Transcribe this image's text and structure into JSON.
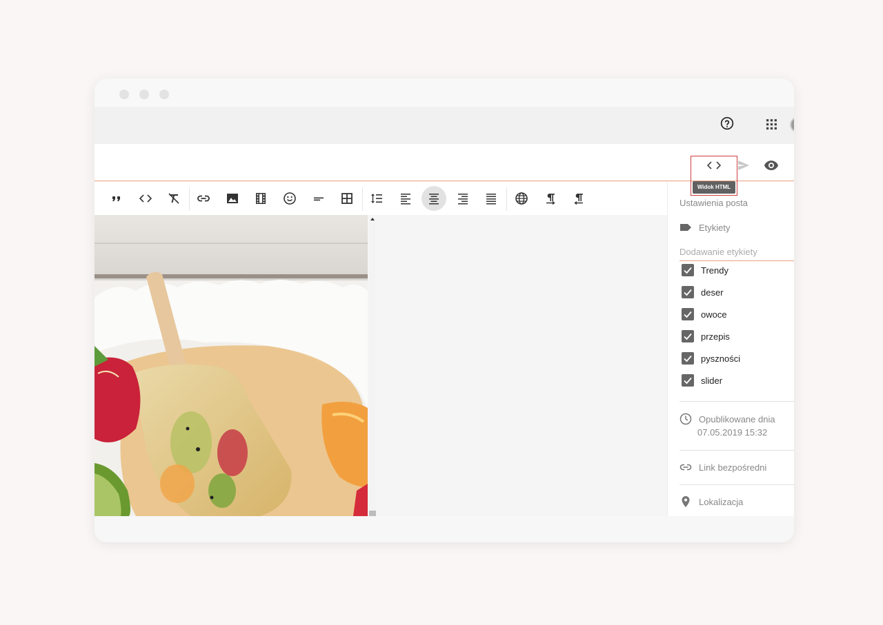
{
  "toolbar": {
    "buttons": [
      {
        "name": "quote-icon"
      },
      {
        "name": "code-icon"
      },
      {
        "name": "clear-formatting-icon"
      },
      {
        "name": "link-icon"
      },
      {
        "name": "image-icon"
      },
      {
        "name": "video-icon"
      },
      {
        "name": "emoji-icon"
      },
      {
        "name": "read-more-icon"
      },
      {
        "name": "table-icon"
      },
      {
        "name": "line-spacing-icon"
      },
      {
        "name": "align-left-icon"
      },
      {
        "name": "align-center-icon",
        "active": true
      },
      {
        "name": "align-right-icon"
      },
      {
        "name": "justify-icon"
      },
      {
        "name": "translate-icon"
      },
      {
        "name": "ltr-icon"
      },
      {
        "name": "rtl-icon"
      }
    ]
  },
  "header": {
    "html_view_tooltip": "Widok HTML"
  },
  "sidebar": {
    "title": "Ustawienia posta",
    "labels_heading": "Etykiety",
    "add_label_placeholder": "Dodawanie etykiety",
    "tags": [
      {
        "label": "Trendy",
        "checked": true
      },
      {
        "label": "deser",
        "checked": true
      },
      {
        "label": "owoce",
        "checked": true
      },
      {
        "label": "przepis",
        "checked": true
      },
      {
        "label": "pyszności",
        "checked": true
      },
      {
        "label": "slider",
        "checked": true
      }
    ],
    "published_label": "Opublikowane dnia",
    "published_date": "07.05.2019 15:32",
    "permalink_label": "Link bezpośredni",
    "location_label": "Lokalizacja"
  },
  "colors": {
    "accent": "#e8a27f",
    "highlight_border": "#cf3d3d",
    "checkbox": "#666666"
  }
}
